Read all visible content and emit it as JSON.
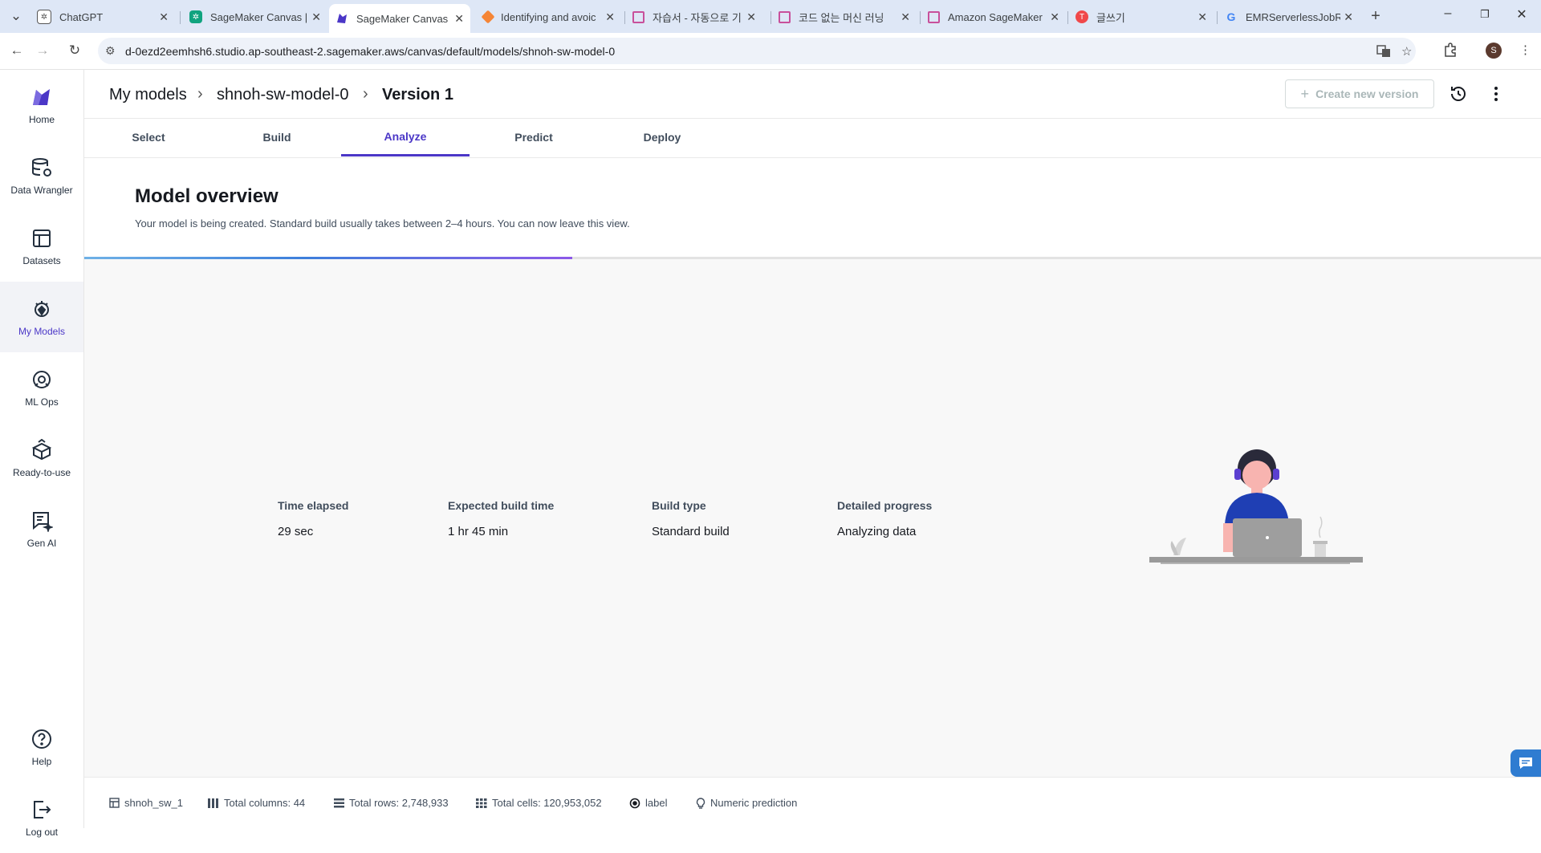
{
  "browser": {
    "tabs": [
      {
        "label": "ChatGPT",
        "icon": "chatgpt-icon",
        "color": "#555555"
      },
      {
        "label": "SageMaker Canvas | …",
        "icon": "chatgpt-icon",
        "color": "#10a37f"
      },
      {
        "label": "SageMaker Canvas",
        "icon": "canvas-icon",
        "color": "#4b37c7"
      },
      {
        "label": "Identifying and avoic",
        "icon": "aws-icon",
        "color": "#f58536"
      },
      {
        "label": "자습서 - 자동으로 기",
        "icon": "cube-icon",
        "color": "#c8509b"
      },
      {
        "label": "코드 없는 머신 러닝",
        "icon": "cube-icon",
        "color": "#c8509b"
      },
      {
        "label": "Amazon SageMaker",
        "icon": "cube-icon",
        "color": "#c8509b"
      },
      {
        "label": "글쓰기",
        "icon": "tistory-icon",
        "color": "#f0484a"
      },
      {
        "label": "EMRServerlessJobRu",
        "icon": "google-icon",
        "color": "#4285f4"
      }
    ],
    "url": "d-0ezd2eemhsh6.studio.ap-southeast-2.sagemaker.aws/canvas/default/models/shnoh-sw-model-0",
    "profile_initial": "S"
  },
  "leftnav": {
    "items": [
      {
        "label": "Home",
        "icon": "canvas-logo-icon"
      },
      {
        "label": "Data Wrangler",
        "icon": "database-icon"
      },
      {
        "label": "Datasets",
        "icon": "table-icon"
      },
      {
        "label": "My Models",
        "icon": "models-icon"
      },
      {
        "label": "ML Ops",
        "icon": "mlops-icon"
      },
      {
        "label": "Ready-to-use",
        "icon": "box-icon"
      },
      {
        "label": "Gen AI",
        "icon": "genai-icon"
      },
      {
        "label": "Help",
        "icon": "help-icon"
      },
      {
        "label": "Log out",
        "icon": "logout-icon"
      }
    ],
    "active": "My Models"
  },
  "header": {
    "breadcrumb": [
      "My models",
      "shnoh-sw-model-0",
      "Version 1"
    ],
    "create_version_label": "Create new version"
  },
  "tabs": [
    "Select",
    "Build",
    "Analyze",
    "Predict",
    "Deploy"
  ],
  "active_tab": "Analyze",
  "overview": {
    "title": "Model overview",
    "subtitle": "Your model is being created. Standard build usually takes between 2–4 hours. You can now leave this view.",
    "progress_percent": 33.5
  },
  "stats": [
    {
      "label": "Time elapsed",
      "value": "29 sec"
    },
    {
      "label": "Expected build time",
      "value": "1 hr 45 min"
    },
    {
      "label": "Build type",
      "value": "Standard build"
    },
    {
      "label": "Detailed progress",
      "value": "Analyzing data"
    }
  ],
  "footer": {
    "dataset": "shnoh_sw_1",
    "total_columns": "Total columns: 44",
    "total_rows": "Total rows: 2,748,933",
    "total_cells": "Total cells: 120,953,052",
    "target": "label",
    "problem_type": "Numeric prediction"
  },
  "colors": {
    "accent": "#4b37c7",
    "chrome": "#dee7f6",
    "content_bg": "#f8f8f8"
  }
}
